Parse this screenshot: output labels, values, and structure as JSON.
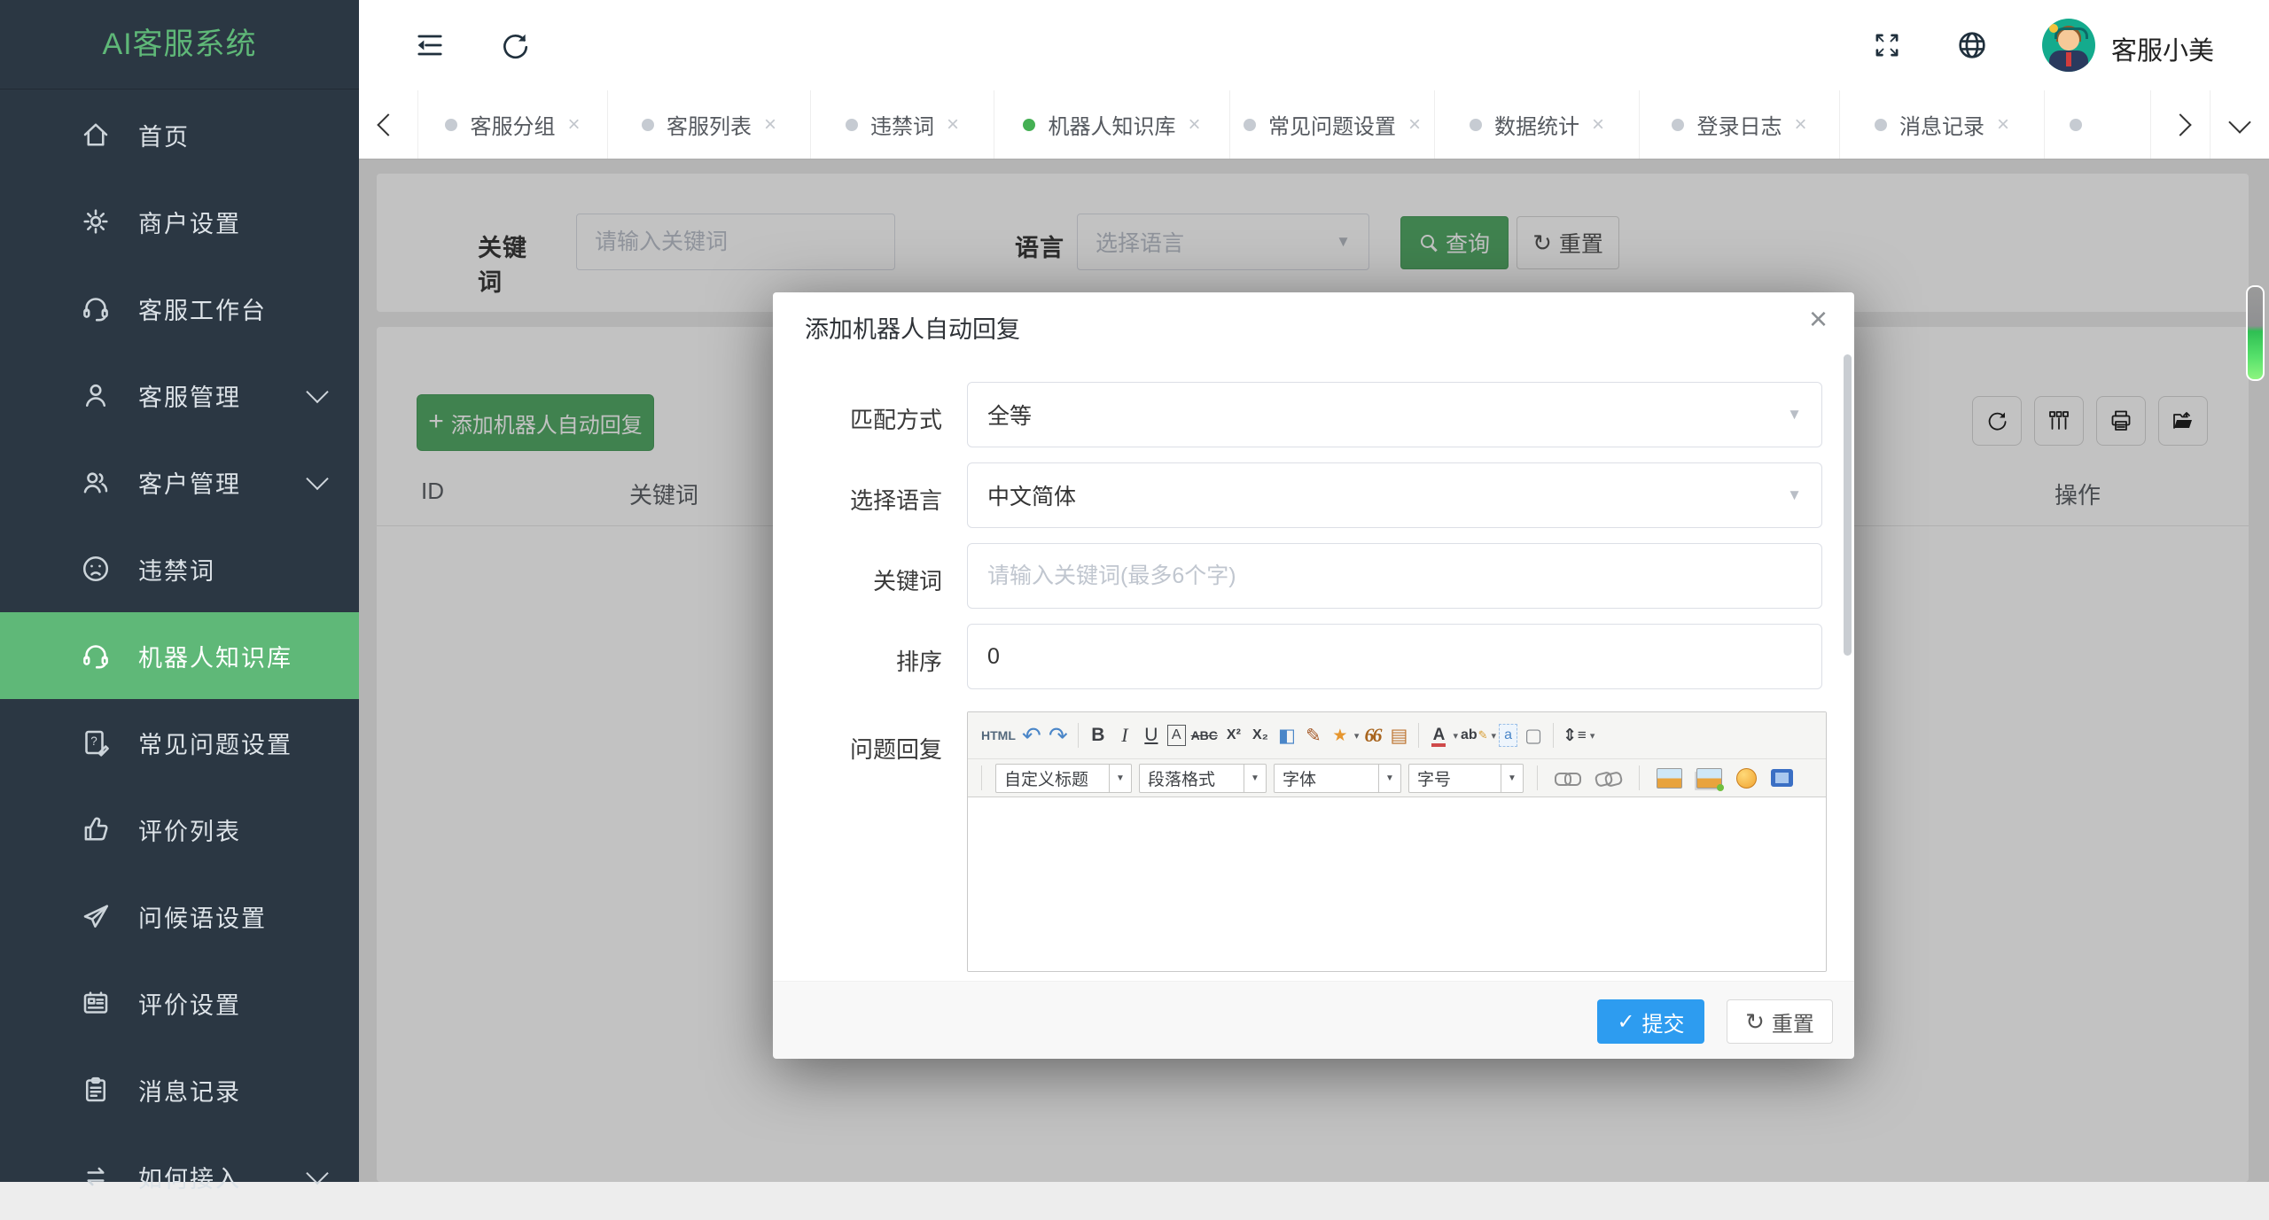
{
  "app": {
    "logo": "AI客服系统"
  },
  "sidebar": {
    "items": [
      {
        "label": "首页",
        "icon": "home"
      },
      {
        "label": "商户设置",
        "icon": "gear"
      },
      {
        "label": "客服工作台",
        "icon": "headset"
      },
      {
        "label": "客服管理",
        "icon": "user",
        "expandable": true
      },
      {
        "label": "客户管理",
        "icon": "users",
        "expandable": true
      },
      {
        "label": "违禁词",
        "icon": "frown"
      },
      {
        "label": "机器人知识库",
        "icon": "headset",
        "active": true
      },
      {
        "label": "常见问题设置",
        "icon": "doc-question"
      },
      {
        "label": "评价列表",
        "icon": "thumbs-up"
      },
      {
        "label": "问候语设置",
        "icon": "paper-plane"
      },
      {
        "label": "评价设置",
        "icon": "card"
      },
      {
        "label": "消息记录",
        "icon": "clipboard"
      },
      {
        "label": "如何接入",
        "icon": "swap",
        "expandable": true
      }
    ]
  },
  "topbar": {
    "username": "客服小美"
  },
  "tabbar": {
    "close_glyph": "×",
    "tabs": [
      {
        "label": "客服分组"
      },
      {
        "label": "客服列表"
      },
      {
        "label": "违禁词"
      },
      {
        "label": "机器人知识库",
        "active": true
      },
      {
        "label": "常见问题设置"
      },
      {
        "label": "数据统计"
      },
      {
        "label": "登录日志"
      },
      {
        "label": "消息记录"
      },
      {
        "label": ""
      }
    ]
  },
  "filter": {
    "keyword_label": "关键词",
    "keyword_placeholder": "请输入关键词",
    "language_label": "语言",
    "language_placeholder": "选择语言",
    "search_label": "查询",
    "reset_label": "重置",
    "reset_glyph": "↻"
  },
  "table": {
    "add_plus": "+",
    "add_label": "添加机器人自动回复",
    "columns": {
      "id": "ID",
      "keyword": "关键词",
      "action": "操作"
    }
  },
  "modal": {
    "title": "添加机器人自动回复",
    "close_glyph": "×",
    "rows": {
      "match_label": "匹配方式",
      "match_value": "全等",
      "lang_label": "选择语言",
      "lang_value": "中文简体",
      "keyword_label": "关键词",
      "keyword_placeholder": "请输入关键词(最多6个字)",
      "sort_label": "排序",
      "sort_value": "0",
      "reply_label": "问题回复"
    },
    "editor": {
      "row1": [
        {
          "n": "html-source-icon",
          "g": "HTML"
        },
        {
          "n": "undo-icon",
          "g": "↶"
        },
        {
          "n": "redo-icon",
          "g": "↷"
        },
        {
          "n": "bold-icon",
          "g": "B"
        },
        {
          "n": "italic-icon",
          "g": "I"
        },
        {
          "n": "underline-icon",
          "g": "U"
        },
        {
          "n": "font-style-icon",
          "g": "A"
        },
        {
          "n": "strikethrough-icon",
          "g": "ABC"
        },
        {
          "n": "superscript-icon",
          "g": "X²"
        },
        {
          "n": "subscript-icon",
          "g": "X₂"
        },
        {
          "n": "remove-format-icon",
          "g": "◧"
        },
        {
          "n": "format-brush-icon",
          "g": "✎"
        },
        {
          "n": "quick-format-icon",
          "g": "★"
        },
        {
          "n": "blockquote-icon",
          "g": "66"
        },
        {
          "n": "paste-plain-icon",
          "g": "▤"
        },
        {
          "n": "font-color-icon",
          "g": "A"
        },
        {
          "n": "highlight-icon",
          "g": "ab"
        },
        {
          "n": "anchor-icon",
          "g": "a"
        },
        {
          "n": "new-page-icon",
          "g": "▢"
        },
        {
          "n": "line-height-icon",
          "g": "⇕"
        }
      ],
      "selects": [
        {
          "label": "自定义标题"
        },
        {
          "label": "段落格式"
        },
        {
          "label": "字体"
        },
        {
          "label": "字号"
        }
      ]
    },
    "footer": {
      "submit_glyph": "✓",
      "submit_label": "提交",
      "reset_glyph": "↻",
      "reset_label": "重置"
    }
  },
  "ui": {
    "caret_down": "▼",
    "caret_small": "▾"
  },
  "colors": {
    "accent_green": "#5FB878",
    "accent_blue": "#2d9cf0",
    "sidebar_bg": "#2b3743"
  }
}
